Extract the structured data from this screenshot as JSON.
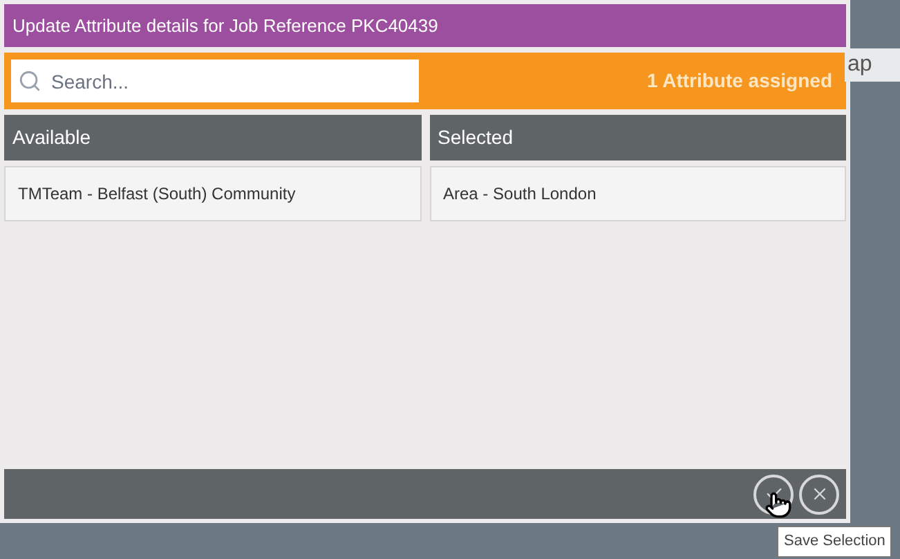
{
  "background": {
    "fragment": "ap"
  },
  "dialog": {
    "title": "Update Attribute details for Job Reference PKC40439",
    "search": {
      "placeholder": "Search..."
    },
    "assigned_count": "1 Attribute assigned",
    "columns": [
      {
        "heading": "Available",
        "items": [
          "TMTeam - Belfast (South) Community"
        ]
      },
      {
        "heading": "Selected",
        "items": [
          "Area - South London"
        ]
      }
    ],
    "tooltip": "Save Selection"
  }
}
